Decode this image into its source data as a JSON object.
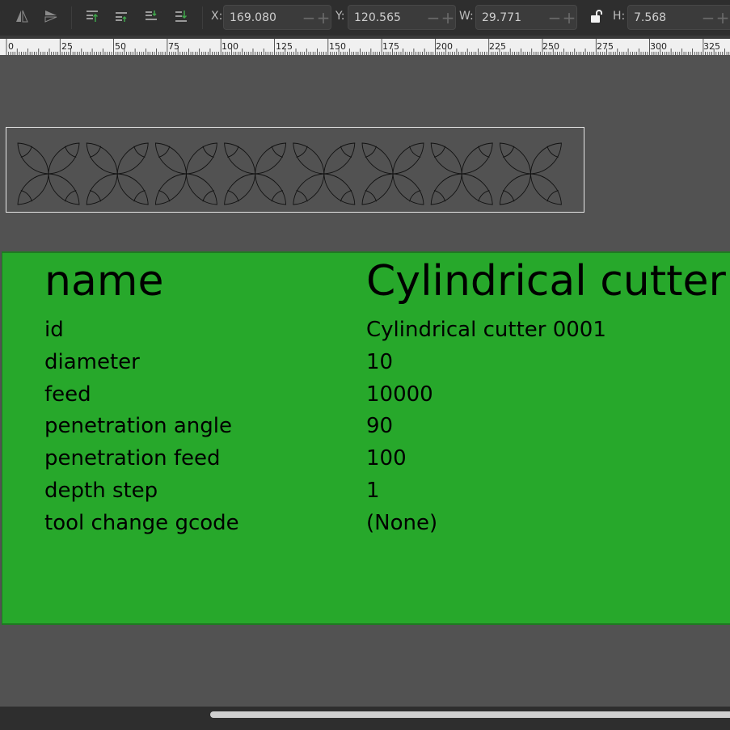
{
  "toolbar": {
    "icons": [
      "flip-horizontal-icon",
      "flip-vertical-icon",
      "raise-to-top-icon",
      "raise-icon",
      "lower-icon",
      "lower-to-bottom-icon"
    ],
    "x": {
      "label": "X:",
      "value": "169.080"
    },
    "y": {
      "label": "Y:",
      "value": "120.565"
    },
    "w": {
      "label": "W:",
      "value": "29.771"
    },
    "h": {
      "label": "H:",
      "value": "7.568"
    },
    "lock_icon": "lock-open-icon",
    "minus": "−",
    "plus": "+"
  },
  "ruler": {
    "labels": [
      "0",
      "25",
      "50",
      "75",
      "100",
      "125",
      "150",
      "175",
      "200",
      "225",
      "250",
      "275",
      "300",
      "325"
    ]
  },
  "tool": {
    "name_label": "name",
    "name_value": "Cylindrical cutter",
    "rows": [
      {
        "key": "id",
        "value": "Cylindrical cutter 0001"
      },
      {
        "key": "diameter",
        "value": "10"
      },
      {
        "key": "feed",
        "value": "10000"
      },
      {
        "key": "penetration angle",
        "value": "90"
      },
      {
        "key": "penetration feed",
        "value": "100"
      },
      {
        "key": "depth step",
        "value": "1"
      },
      {
        "key": "tool change gcode",
        "value": "(None)"
      }
    ]
  },
  "colors": {
    "canvas": "#525252",
    "toolbar": "#2e2e2e",
    "tool_card": "#27a82b",
    "ruler": "#f0f0f0"
  }
}
